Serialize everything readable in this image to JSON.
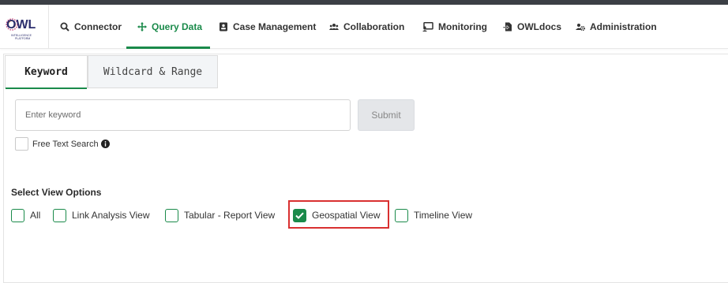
{
  "logo": {
    "text": "OWL",
    "sub": "INTELLIGENCE PLATFORM"
  },
  "nav": {
    "items": [
      {
        "label": "Connector",
        "icon": "search-icon",
        "active": false
      },
      {
        "label": "Query Data",
        "icon": "move-arrows-icon",
        "active": true
      },
      {
        "label": "Case Management",
        "icon": "id-card-icon",
        "active": false
      },
      {
        "label": "Collaboration",
        "icon": "users-icon",
        "active": false
      },
      {
        "label": "Monitoring",
        "icon": "monitor-user-icon",
        "active": false
      },
      {
        "label": "OWLdocs",
        "icon": "doc-arrow-icon",
        "active": false
      },
      {
        "label": "Administration",
        "icon": "users-cog-icon",
        "active": false
      }
    ]
  },
  "tabs": {
    "keyword": "Keyword",
    "wildcard": "Wildcard & Range",
    "active": "keyword"
  },
  "search": {
    "placeholder": "Enter keyword",
    "value": "",
    "submit_label": "Submit",
    "submit_disabled": true
  },
  "free_text": {
    "label": "Free Text Search",
    "checked": false,
    "info_icon": "info-circle-icon"
  },
  "view_options": {
    "title": "Select View Options",
    "options": [
      {
        "label": "All",
        "checked": false
      },
      {
        "label": "Link Analysis View",
        "checked": false
      },
      {
        "label": "Tabular - Report View",
        "checked": false
      },
      {
        "label": "Geospatial View",
        "checked": true
      },
      {
        "label": "Timeline View",
        "checked": false
      }
    ]
  },
  "colors": {
    "accent": "#1a8a4a",
    "highlight": "#d93030",
    "topbar": "#3b3f45"
  }
}
